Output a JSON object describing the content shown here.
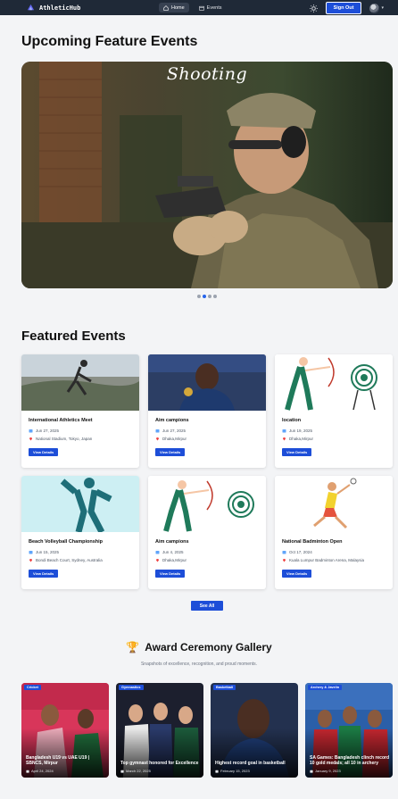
{
  "nav": {
    "brand": "AthleticHub",
    "links": [
      {
        "label": "Home",
        "icon": "home-icon",
        "active": true
      },
      {
        "label": "Events",
        "icon": "calendar-icon",
        "active": false
      }
    ],
    "signout_label": "Sign Out"
  },
  "hero": {
    "heading": "Upcoming Feature Events",
    "slide_title": "Shooting",
    "slide_count": 4,
    "active_slide": 1
  },
  "featured": {
    "heading": "Featured Events",
    "button_label": "View Details",
    "see_all_label": "See All",
    "events": [
      {
        "title": "International Athletics Meet",
        "date": "Jun 27, 2025",
        "location": "National Stadium, Tokyo, Japan"
      },
      {
        "title": "Aim campions",
        "date": "Jun 27, 2025",
        "location": "Dhaka,Mirpur"
      },
      {
        "title": "location",
        "date": "Jun 19, 2025",
        "location": "Dhaka,Mirpur"
      },
      {
        "title": "Beach Volleyball Championship",
        "date": "Jun 15, 2025",
        "location": "Bondi Beach Court, Sydney, Australia"
      },
      {
        "title": "Aim campions",
        "date": "Jun 4, 2025",
        "location": "Dhaka,Mirpur"
      },
      {
        "title": "National Badminton Open",
        "date": "Oct 17, 2024",
        "location": "Kuala Lumpur Badminton Arena, Malaysia"
      }
    ]
  },
  "gallery": {
    "heading": "Award Ceremony Gallery",
    "trophy": "🏆",
    "subtitle": "Snapshots of excellence, recognition, and proud moments.",
    "items": [
      {
        "badge": "Cricket",
        "title": "Bangladesh U19 vs UAE U19 | SBNCS, Mirpur",
        "date": "April 24, 2024"
      },
      {
        "badge": "Gymnastics",
        "title": "Top gymnast honored for Excellence",
        "date": "March 22, 2025"
      },
      {
        "badge": "Basketball",
        "title": "Highest record goal in basketball",
        "date": "February 15, 2023"
      },
      {
        "badge": "Archery & Javelin",
        "title": "SA Games: Bangladesh clinch record 10 gold medals; all 10 in archery",
        "date": "January 9, 2023"
      }
    ]
  },
  "colors": {
    "nav_bg": "#1f2937",
    "primary": "#1d4ed8",
    "page_bg": "#f3f4f6"
  }
}
